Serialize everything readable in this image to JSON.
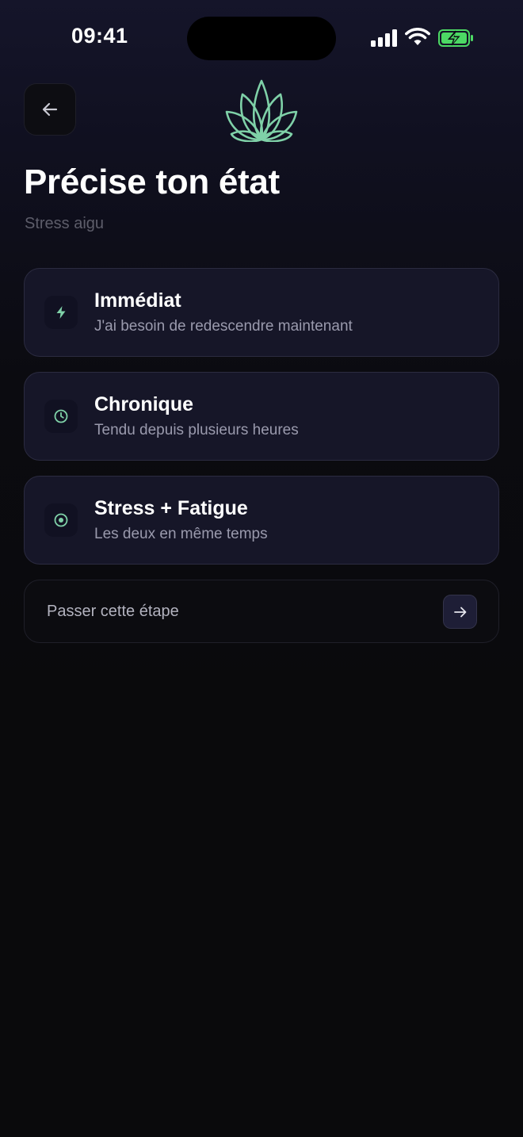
{
  "status_bar": {
    "time": "09:41",
    "icons": [
      "signal-icon",
      "wifi-icon",
      "battery-charging-icon"
    ],
    "battery_color": "#4cd964"
  },
  "header": {
    "back_icon": "arrow-left-icon",
    "logo_icon": "lotus-logo-icon",
    "accent_color": "#7fd1a8"
  },
  "page": {
    "title": "Précise ton état",
    "subtitle": "Stress aigu"
  },
  "options": [
    {
      "icon": "lightning-icon",
      "label": "Immédiat",
      "description": "J'ai besoin de redescendre maintenant"
    },
    {
      "icon": "clock-icon",
      "label": "Chronique",
      "description": "Tendu depuis plusieurs heures"
    },
    {
      "icon": "target-icon",
      "label": "Stress + Fatigue",
      "description": "Les deux en même temps"
    }
  ],
  "skip": {
    "label": "Passer cette étape",
    "icon": "arrow-right-icon"
  }
}
